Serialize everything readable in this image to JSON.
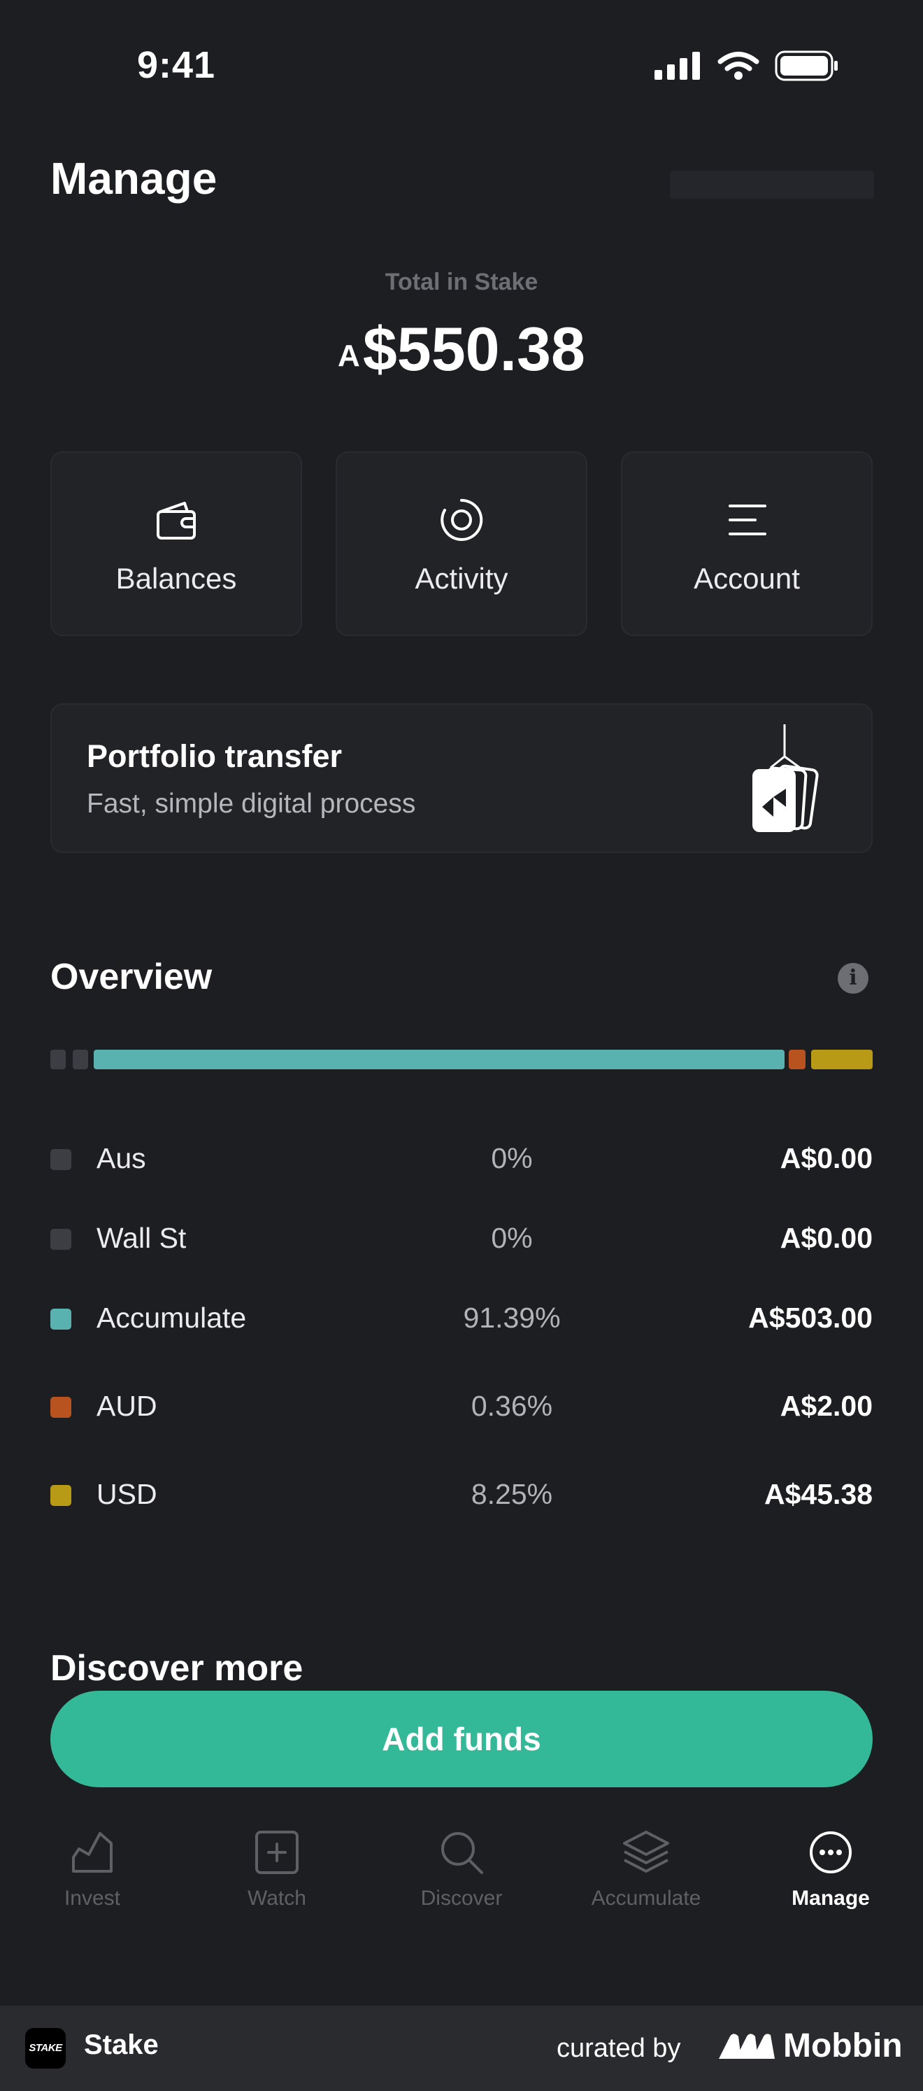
{
  "status_bar": {
    "time": "9:41"
  },
  "header": {
    "title": "Manage"
  },
  "total": {
    "label": "Total in Stake",
    "currency": "A",
    "amount": "$550.38"
  },
  "actions": [
    {
      "label": "Balances",
      "icon": "wallet-icon"
    },
    {
      "label": "Activity",
      "icon": "activity-icon"
    },
    {
      "label": "Account",
      "icon": "menu-lines-icon"
    }
  ],
  "promo": {
    "title": "Portfolio transfer",
    "subtitle": "Fast, simple digital process",
    "icon": "transfer-box-icon"
  },
  "overview": {
    "title": "Overview",
    "rows": [
      {
        "name": "Aus",
        "pct": "0%",
        "value": "A$0.00",
        "fraction": 0,
        "color": "#3d3e43"
      },
      {
        "name": "Wall St",
        "pct": "0%",
        "value": "A$0.00",
        "fraction": 0,
        "color": "#3d3e43"
      },
      {
        "name": "Accumulate",
        "pct": "91.39%",
        "value": "A$503.00",
        "fraction": 0.9139,
        "color": "#59b2b0"
      },
      {
        "name": "AUD",
        "pct": "0.36%",
        "value": "A$2.00",
        "fraction": 0.0036,
        "color": "#b8521e"
      },
      {
        "name": "USD",
        "pct": "8.25%",
        "value": "A$45.38",
        "fraction": 0.0825,
        "color": "#b99a17"
      }
    ]
  },
  "discover": {
    "title": "Discover more"
  },
  "cta": {
    "label": "Add funds",
    "color": "#33b898"
  },
  "tabs": [
    {
      "label": "Invest",
      "icon": "chart-icon"
    },
    {
      "label": "Watch",
      "icon": "plus-square-icon"
    },
    {
      "label": "Discover",
      "icon": "search-icon"
    },
    {
      "label": "Accumulate",
      "icon": "layers-icon"
    },
    {
      "label": "Manage",
      "icon": "more-circle-icon",
      "active": true
    }
  ],
  "footer": {
    "logo_text": "STAKE",
    "app_name": "Stake",
    "curated_by": "curated by",
    "brand": "Mobbin"
  }
}
